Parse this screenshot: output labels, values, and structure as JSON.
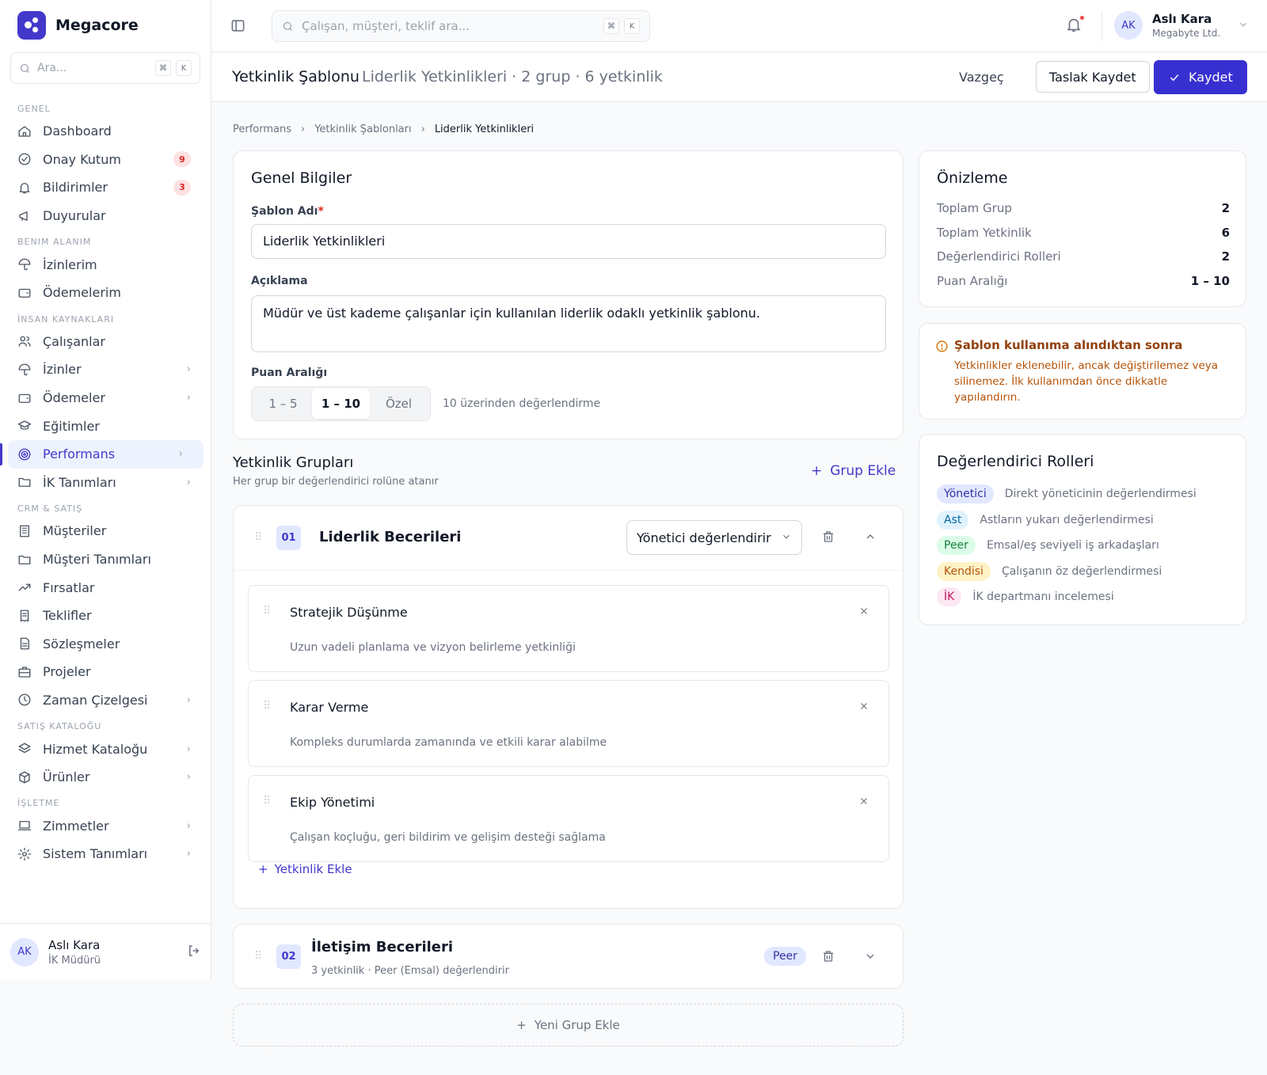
{
  "brand": {
    "name": "Megacore"
  },
  "sidebar": {
    "search_placeholder": "Ara...",
    "kbd1": "⌘",
    "kbd2": "K",
    "sections": [
      {
        "title": "GENEL",
        "items": [
          {
            "label": "Dashboard",
            "icon": "home-icon"
          },
          {
            "label": "Onay Kutum",
            "icon": "check-circle-icon",
            "badge": "9"
          },
          {
            "label": "Bildirimler",
            "icon": "bell-icon",
            "badge": "3"
          },
          {
            "label": "Duyurular",
            "icon": "megaphone-icon"
          }
        ]
      },
      {
        "title": "BENIM ALANIM",
        "items": [
          {
            "label": "İzinlerim",
            "icon": "umbrella-icon"
          },
          {
            "label": "Ödemelerim",
            "icon": "wallet-icon"
          }
        ]
      },
      {
        "title": "İNSAN KAYNAKLARI",
        "items": [
          {
            "label": "Çalışanlar",
            "icon": "users-icon"
          },
          {
            "label": "İzinler",
            "icon": "umbrella-icon",
            "chevron": true
          },
          {
            "label": "Ödemeler",
            "icon": "wallet-icon",
            "chevron": true
          },
          {
            "label": "Eğitimler",
            "icon": "graduation-cap-icon"
          },
          {
            "label": "Performans",
            "icon": "target-icon",
            "chevron": true,
            "active": true
          },
          {
            "label": "İK Tanımları",
            "icon": "folder-icon",
            "chevron": true
          }
        ]
      },
      {
        "title": "CRM & SATIŞ",
        "items": [
          {
            "label": "Müşteriler",
            "icon": "building-icon"
          },
          {
            "label": "Müşteri Tanımları",
            "icon": "folder-icon"
          },
          {
            "label": "Fırsatlar",
            "icon": "trending-up-icon"
          },
          {
            "label": "Teklifler",
            "icon": "receipt-icon"
          },
          {
            "label": "Sözleşmeler",
            "icon": "file-text-icon"
          },
          {
            "label": "Projeler",
            "icon": "briefcase-icon"
          },
          {
            "label": "Zaman Çizelgesi",
            "icon": "clock-icon",
            "chevron": true
          }
        ]
      },
      {
        "title": "SATIŞ KATALOĞU",
        "items": [
          {
            "label": "Hizmet Kataloğu",
            "icon": "layers-icon",
            "chevron": true
          },
          {
            "label": "Ürünler",
            "icon": "box-icon",
            "chevron": true
          }
        ]
      },
      {
        "title": "İŞLETME",
        "items": [
          {
            "label": "Zimmetler",
            "icon": "laptop-icon",
            "chevron": true
          },
          {
            "label": "Sistem Tanımları",
            "icon": "gear-icon",
            "chevron": true
          }
        ]
      }
    ],
    "footer": {
      "initials": "AK",
      "name": "Aslı Kara",
      "role": "İK Müdürü"
    }
  },
  "topbar": {
    "search_placeholder": "Çalışan, müşteri, teklif ara...",
    "kbd1": "⌘",
    "kbd2": "K",
    "user": {
      "initials": "AK",
      "name": "Aslı Kara",
      "company": "Megabyte Ltd."
    }
  },
  "header": {
    "title": "Yetkinlik Şablonu",
    "subtitle": "Liderlik Yetkinlikleri · 2 grup · 6 yetkinlik",
    "cancel": "Vazgeç",
    "draft": "Taslak Kaydet",
    "save": "Kaydet"
  },
  "breadcrumb": [
    "Performans",
    "Yetkinlik Şablonları",
    "Liderlik Yetkinlikleri"
  ],
  "general": {
    "title": "Genel Bilgiler",
    "name_label": "Şablon Adı",
    "name_value": "Liderlik Yetkinlikleri",
    "desc_label": "Açıklama",
    "desc_value": "Müdür ve üst kademe çalışanlar için kullanılan liderlik odaklı yetkinlik şablonu.",
    "range_label": "Puan Aralığı",
    "range_options": [
      "1 – 5",
      "1 – 10",
      "Özel"
    ],
    "range_selected": "1 – 10",
    "range_hint": "10 üzerinden değerlendirme"
  },
  "groups": {
    "title": "Yetkinlik Grupları",
    "subtitle": "Her grup bir değerlendirici rolüne atanır",
    "add_label": "Grup Ekle",
    "new_group_label": "Yeni Grup Ekle",
    "group1": {
      "number": "01",
      "name": "Liderlik Becerileri",
      "role": "Yönetici değerlendirir",
      "competencies": [
        {
          "name": "Stratejik Düşünme",
          "desc": "Uzun vadeli planlama ve vizyon belirleme yetkinliği"
        },
        {
          "name": "Karar Verme",
          "desc": "Kompleks durumlarda zamanında ve etkili karar alabilme"
        },
        {
          "name": "Ekip Yönetimi",
          "desc": "Çalışan koçluğu, geri bildirim ve gelişim desteği sağlama"
        }
      ],
      "add_comp_label": "Yetkinlik Ekle"
    },
    "group2": {
      "number": "02",
      "name": "İletişim Becerileri",
      "sub": "3 yetkinlik · Peer (Emsal) değerlendirir",
      "badge": "Peer"
    }
  },
  "preview": {
    "title": "Önizleme",
    "rows": [
      {
        "label": "Toplam Grup",
        "value": "2"
      },
      {
        "label": "Toplam Yetkinlik",
        "value": "6"
      },
      {
        "label": "Değerlendirici Rolleri",
        "value": "2"
      },
      {
        "label": "Puan Aralığı",
        "value": "1 – 10"
      }
    ]
  },
  "warning": {
    "title": "Şablon kullanıma alındıktan sonra",
    "text": "Yetkinlikler eklenebilir, ancak değiştirilemez veya silinemez. İlk kullanımdan önce dikkatle yapılandırın."
  },
  "roles": {
    "title": "Değerlendirici Rolleri",
    "items": [
      {
        "badge": "Yönetici",
        "desc": "Direkt yöneticinin değerlendirmesi",
        "bg": "#e0e7ff",
        "fg": "#3730a3"
      },
      {
        "badge": "Ast",
        "desc": "Astların yukarı değerlendirmesi",
        "bg": "#e0f2fe",
        "fg": "#0369a1"
      },
      {
        "badge": "Peer",
        "desc": "Emsal/eş seviyeli iş arkadaşları",
        "bg": "#dcfce7",
        "fg": "#15803d"
      },
      {
        "badge": "Kendisi",
        "desc": "Çalışanın öz değerlendirmesi",
        "bg": "#fef3c7",
        "fg": "#b45309"
      },
      {
        "badge": "İK",
        "desc": "İK departmanı incelemesi",
        "bg": "#fce7f3",
        "fg": "#be185d"
      }
    ]
  },
  "colors": {
    "accent": "#3730d0",
    "accent_light": "#eef2ff",
    "warning": "#b45309",
    "danger": "#dc2626"
  }
}
